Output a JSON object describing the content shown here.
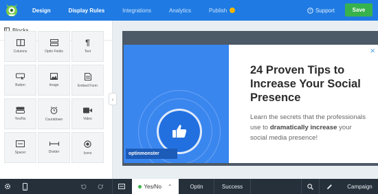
{
  "topbar": {
    "tabs": [
      {
        "label": "Design"
      },
      {
        "label": "Display Rules"
      },
      {
        "label": "Integrations"
      },
      {
        "label": "Analytics"
      },
      {
        "label": "Publish"
      }
    ],
    "support_label": "Support",
    "save_label": "Save"
  },
  "sidebar": {
    "title": "Blocks",
    "blocks": [
      {
        "label": "Columns",
        "icon": "columns-icon"
      },
      {
        "label": "Optin Fields",
        "icon": "optin-fields-icon"
      },
      {
        "label": "Text",
        "icon": "text-icon"
      },
      {
        "label": "Button",
        "icon": "button-icon"
      },
      {
        "label": "Image",
        "icon": "image-icon"
      },
      {
        "label": "Embed Form",
        "icon": "embed-form-icon"
      },
      {
        "label": "Yes/No",
        "icon": "yes-no-icon"
      },
      {
        "label": "Countdown",
        "icon": "countdown-icon"
      },
      {
        "label": "Video",
        "icon": "video-icon"
      },
      {
        "label": "Spacer",
        "icon": "spacer-icon"
      },
      {
        "label": "Divider",
        "icon": "divider-icon"
      },
      {
        "label": "Icons",
        "icon": "icons-icon"
      }
    ]
  },
  "popup": {
    "title": "24 Proven Tips to Increase Your Social Presence",
    "body_before": "Learn the secrets that the professionals use to ",
    "body_bold": "dramatically increase",
    "body_after": " your social media presence!",
    "brand": "optinmonster"
  },
  "bottombar": {
    "views": [
      {
        "label": "Yes/No"
      },
      {
        "label": "Optin"
      },
      {
        "label": "Success"
      }
    ],
    "campaign_label": "Campaign"
  },
  "colors": {
    "topbar": "#1f7be3",
    "save": "#37b24d",
    "popup_left": "#3a86ef",
    "bottombar": "#26303b"
  }
}
